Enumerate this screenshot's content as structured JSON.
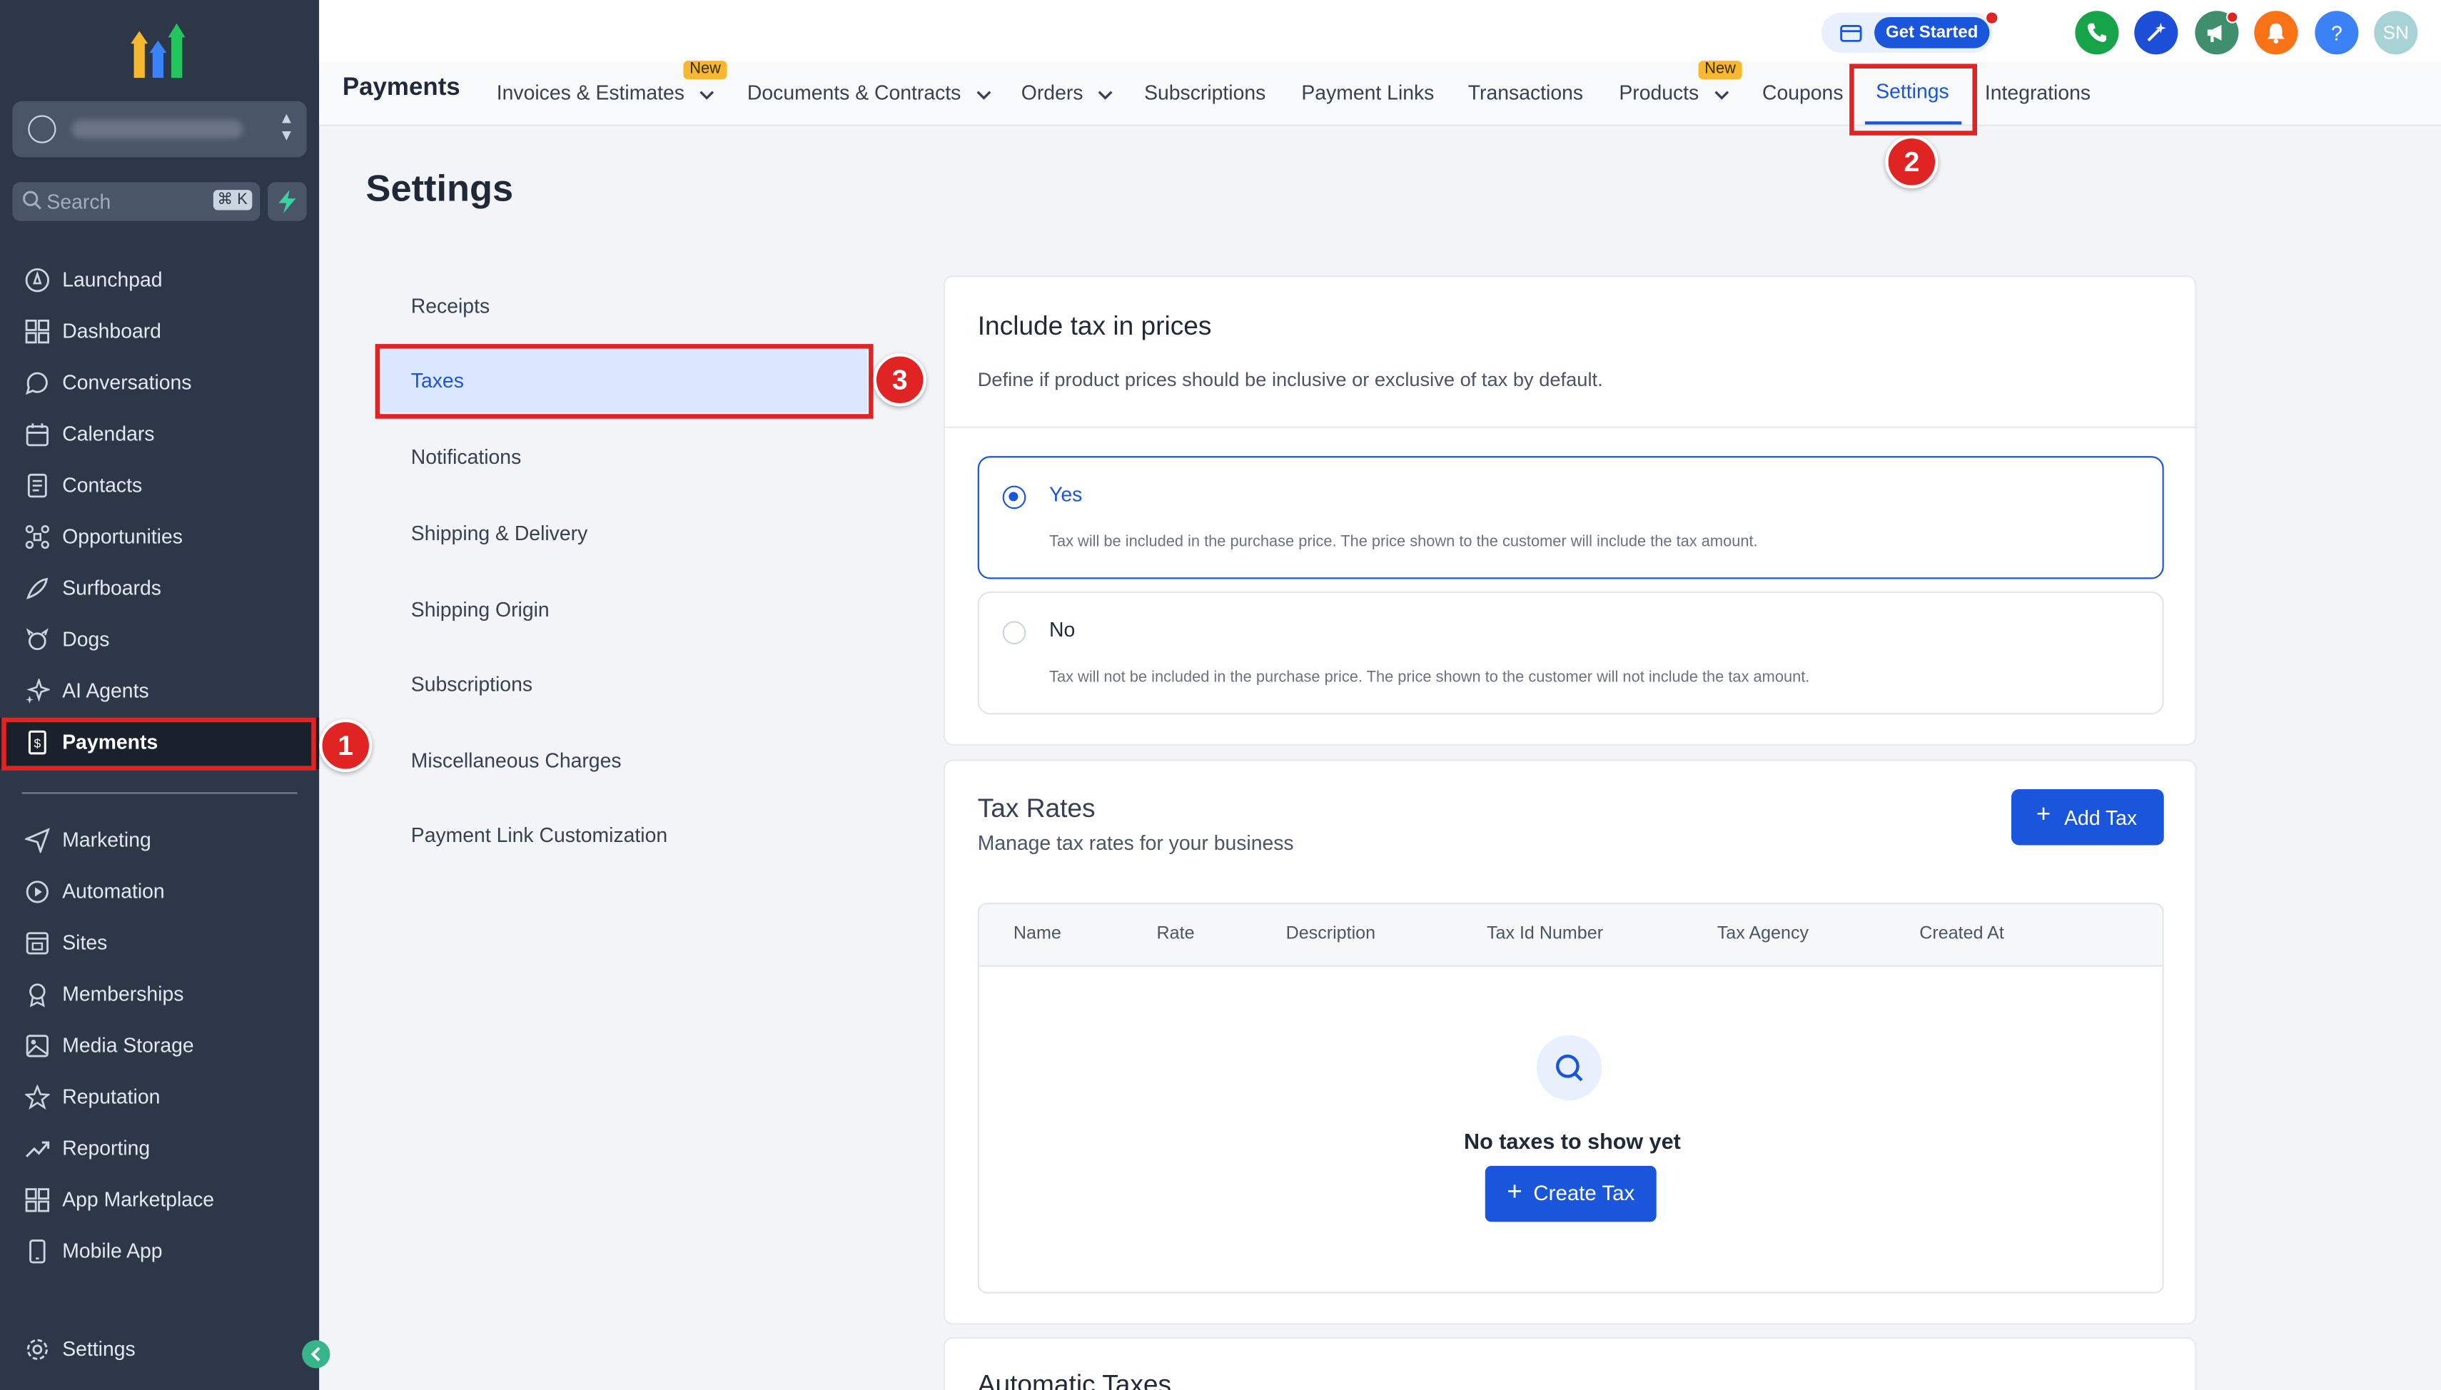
{
  "sidebar": {
    "search_label": "Search",
    "search_shortcut": "⌘ K",
    "items": [
      {
        "label": "Launchpad"
      },
      {
        "label": "Dashboard"
      },
      {
        "label": "Conversations"
      },
      {
        "label": "Calendars"
      },
      {
        "label": "Contacts"
      },
      {
        "label": "Opportunities"
      },
      {
        "label": "Surfboards"
      },
      {
        "label": "Dogs"
      },
      {
        "label": "AI Agents"
      },
      {
        "label": "Payments"
      }
    ],
    "items2": [
      {
        "label": "Marketing"
      },
      {
        "label": "Automation"
      },
      {
        "label": "Sites"
      },
      {
        "label": "Memberships"
      },
      {
        "label": "Media Storage"
      },
      {
        "label": "Reputation"
      },
      {
        "label": "Reporting"
      },
      {
        "label": "App Marketplace"
      },
      {
        "label": "Mobile App"
      }
    ],
    "settings_label": "Settings"
  },
  "topbar": {
    "get_started": "Get Started",
    "avatar_initials": "SN"
  },
  "subnav": {
    "brand": "Payments",
    "new_badge": "New",
    "tabs": [
      {
        "label": "Invoices & Estimates"
      },
      {
        "label": "Documents & Contracts"
      },
      {
        "label": "Orders"
      },
      {
        "label": "Subscriptions"
      },
      {
        "label": "Payment Links"
      },
      {
        "label": "Transactions"
      },
      {
        "label": "Products"
      },
      {
        "label": "Coupons"
      },
      {
        "label": "Settings"
      },
      {
        "label": "Integrations"
      }
    ]
  },
  "annotations": [
    "1",
    "2",
    "3"
  ],
  "page": {
    "title": "Settings",
    "menu": [
      {
        "label": "Receipts"
      },
      {
        "label": "Taxes"
      },
      {
        "label": "Notifications"
      },
      {
        "label": "Shipping & Delivery"
      },
      {
        "label": "Shipping Origin"
      },
      {
        "label": "Subscriptions"
      },
      {
        "label": "Miscellaneous Charges"
      },
      {
        "label": "Payment Link Customization"
      }
    ]
  },
  "include_tax": {
    "title": "Include tax in prices",
    "description": "Define if product prices should be inclusive or exclusive of tax by default.",
    "options": [
      {
        "label": "Yes",
        "description": "Tax will be included in the purchase price. The price shown to the customer will include the tax amount."
      },
      {
        "label": "No",
        "description": "Tax will not be included in the purchase price. The price shown to the customer will not include the tax amount."
      }
    ]
  },
  "tax_rates": {
    "title": "Tax Rates",
    "subtitle": "Manage tax rates for your business",
    "add_button": "Add Tax",
    "columns": [
      "Name",
      "Rate",
      "Description",
      "Tax Id Number",
      "Tax Agency",
      "Created At"
    ],
    "empty_text": "No taxes to show yet",
    "create_button": "Create Tax"
  },
  "automatic_taxes": {
    "title": "Automatic Taxes"
  },
  "colors": {
    "sidebar_bg": "#2d3748",
    "accent": "#1a56db",
    "annotation": "#e02424"
  }
}
